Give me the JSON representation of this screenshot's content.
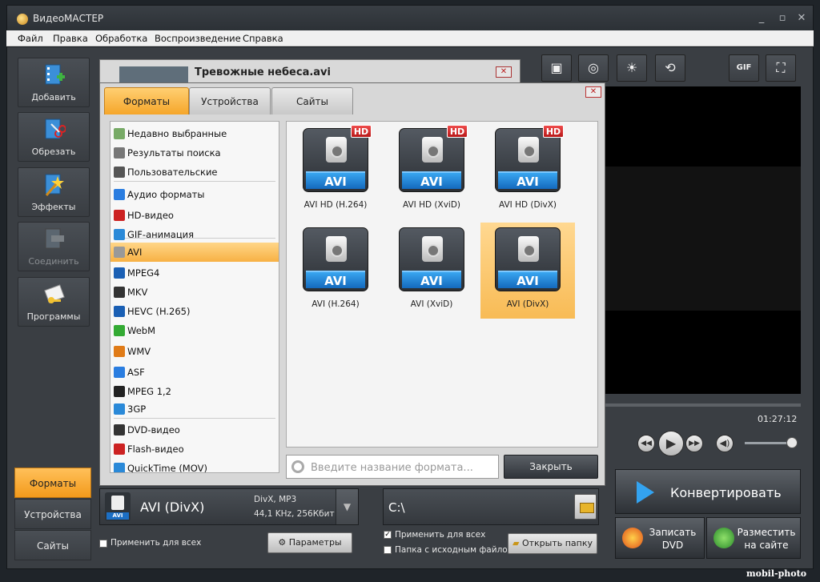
{
  "window": {
    "title": "ВидеоМАСТЕР",
    "min": "_",
    "max": "▫",
    "close": "✕"
  },
  "menu": [
    "Файл",
    "Правка",
    "Обработка",
    "Воспроизведение",
    "Справка"
  ],
  "left_toolbar": [
    {
      "label": "Добавить",
      "icon": "add-video-icon",
      "enabled": true
    },
    {
      "label": "Обрезать",
      "icon": "scissors-icon",
      "enabled": true
    },
    {
      "label": "Эффекты",
      "icon": "magic-wand-icon",
      "enabled": true
    },
    {
      "label": "Соединить",
      "icon": "join-icon",
      "enabled": false
    },
    {
      "label": "Программы",
      "icon": "programs-icon",
      "enabled": true
    }
  ],
  "left_tabs": [
    "Форматы",
    "Устройства",
    "Сайты"
  ],
  "file": {
    "name": "Тревожные небеса.avi"
  },
  "dialog": {
    "tabs": [
      "Форматы",
      "Устройства",
      "Сайты"
    ],
    "categories": [
      {
        "label": "Недавно выбранные",
        "icon": "recent-icon",
        "color": "#7a6"
      },
      {
        "label": "Результаты поиска",
        "icon": "search-icon",
        "color": "#777"
      },
      {
        "label": "Пользовательские",
        "icon": "user-icon",
        "color": "#555"
      },
      {
        "label": "Аудио форматы",
        "icon": "music-note-icon",
        "color": "#2a7de0"
      },
      {
        "label": "HD-видео",
        "icon": "hd-icon",
        "color": "#c22"
      },
      {
        "label": "GIF-анимация",
        "icon": "gif-icon",
        "color": "#2a89d8"
      },
      {
        "label": "AVI",
        "icon": "avi-disc-icon",
        "color": "#999"
      },
      {
        "label": "MPEG4",
        "icon": "mp4-icon",
        "color": "#1a5fb4"
      },
      {
        "label": "MKV",
        "icon": "mkv-icon",
        "color": "#333"
      },
      {
        "label": "HEVC (H.265)",
        "icon": "hevc-icon",
        "color": "#1a5fb4"
      },
      {
        "label": "WebM",
        "icon": "webm-icon",
        "color": "#3a3"
      },
      {
        "label": "WMV",
        "icon": "wmv-icon",
        "color": "#e07b18"
      },
      {
        "label": "ASF",
        "icon": "asf-icon",
        "color": "#2a7de0"
      },
      {
        "label": "MPEG 1,2",
        "icon": "mpeg-icon",
        "color": "#222"
      },
      {
        "label": "3GP",
        "icon": "phone-icon",
        "color": "#2a89d8"
      },
      {
        "label": "DVD-видео",
        "icon": "dvd-icon",
        "color": "#333"
      },
      {
        "label": "Flash-видео",
        "icon": "flash-icon",
        "color": "#c22"
      },
      {
        "label": "QuickTime (MOV)",
        "icon": "quicktime-icon",
        "color": "#2a89d8"
      }
    ],
    "active_category": "AVI",
    "formats": [
      {
        "label": "AVI HD (H.264)",
        "badge": "AVI",
        "hd": "HD"
      },
      {
        "label": "AVI HD (XviD)",
        "badge": "AVI",
        "hd": "HD"
      },
      {
        "label": "AVI HD (DivX)",
        "badge": "AVI",
        "hd": "HD"
      },
      {
        "label": "AVI (H.264)",
        "badge": "AVI",
        "hd": ""
      },
      {
        "label": "AVI (XviD)",
        "badge": "AVI",
        "hd": ""
      },
      {
        "label": "AVI (DivX)",
        "badge": "AVI",
        "hd": ""
      }
    ],
    "active_format": "AVI (DivX)",
    "search_placeholder": "Введите название формата...",
    "close_label": "Закрыть",
    "close_x": "✕"
  },
  "output": {
    "format_name": "AVI (DivX)",
    "format_badge": "AVI",
    "codec_line": "DivX, MP3",
    "audio_line": "44,1 KHz, 256Кбит",
    "apply_all": "Применить для всех",
    "params": "Параметры"
  },
  "folder": {
    "path": "C:\\",
    "apply_all": "Применить для всех",
    "source_folder": "Папка с исходным файлом",
    "open_folder": "Открыть папку"
  },
  "player": {
    "timecode": "01:27:12"
  },
  "actions": {
    "convert": "Конвертировать",
    "burn_dvd": "Записать DVD",
    "publish": "Разместить на сайте"
  },
  "watermark": "mobil-photo"
}
